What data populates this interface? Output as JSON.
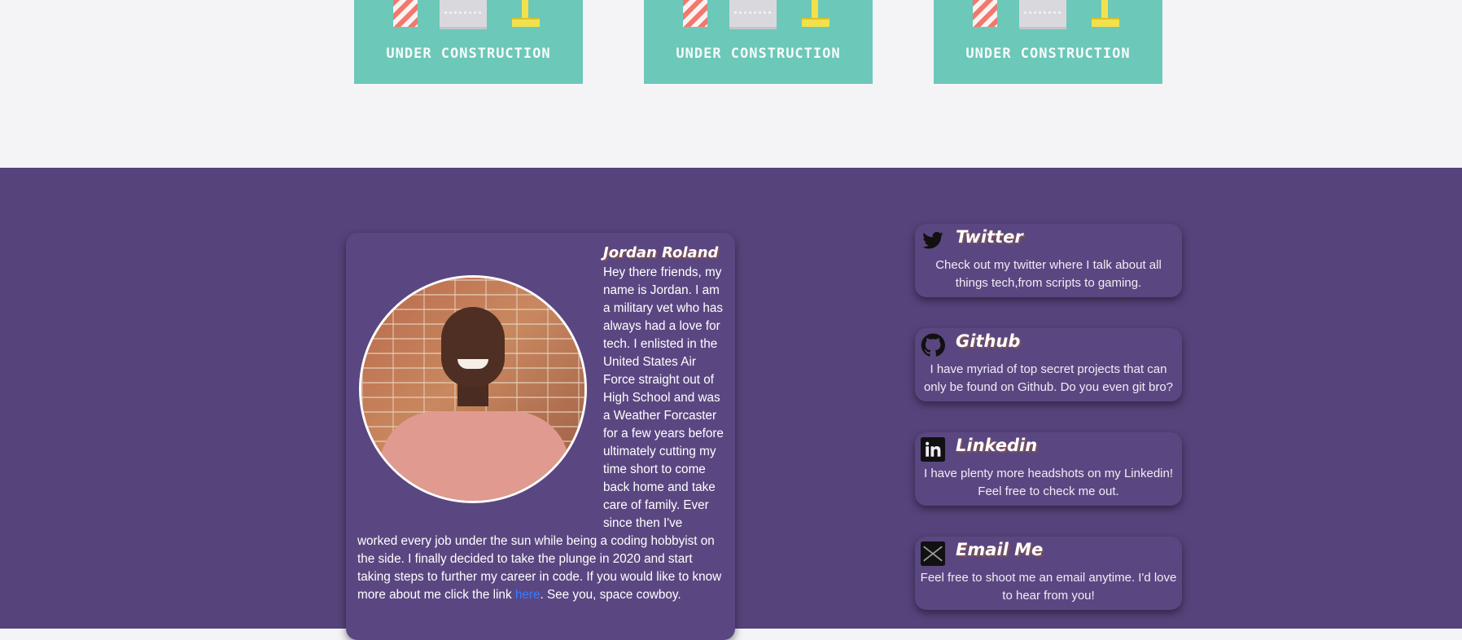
{
  "projects": {
    "cards": [
      {
        "caption": "UNDER CONSTRUCTION"
      },
      {
        "caption": "UNDER CONSTRUCTION"
      },
      {
        "caption": "UNDER CONSTRUCTION"
      }
    ]
  },
  "about": {
    "name": "Jordan Roland",
    "bio_before_link": "Hey there friends, my name is Jordan. I am a military vet who has always had a love for tech. I enlisted in the United States Air Force straight out of High School and was a Weather Forcaster for a few years before ultimately cutting my time short to come back home and take care of family. Ever since then I've worked every job under the sun while being a coding hobbyist on the side. I finally decided to take the plunge in 2020 and start taking steps to further my career in code. If you would like to know more about me click the link",
    "link_text": "here",
    "bio_after_link": ". See you, space cowboy.",
    "link_color": "#3b7bff"
  },
  "social": [
    {
      "title": "Twitter",
      "icon": "twitter-bird-icon",
      "desc": "Check out my twitter where I talk about all things tech,from scripts to gaming."
    },
    {
      "title": "Github",
      "icon": "github-octocat-icon",
      "desc": "I have myriad of top secret projects that can only be found on Github. Do you even git bro?"
    },
    {
      "title": "Linkedin",
      "icon": "linkedin-icon",
      "desc": "I have plenty more headshots on my Linkedin! Feel free to check me out."
    },
    {
      "title": "Email Me",
      "icon": "email-envelope-icon",
      "desc": "Feel free to shoot me an email anytime. I'd love to hear from you!"
    }
  ],
  "colors": {
    "teal": "#6cc8b9",
    "purple": "#56437b",
    "background": "#f4f4f7"
  }
}
